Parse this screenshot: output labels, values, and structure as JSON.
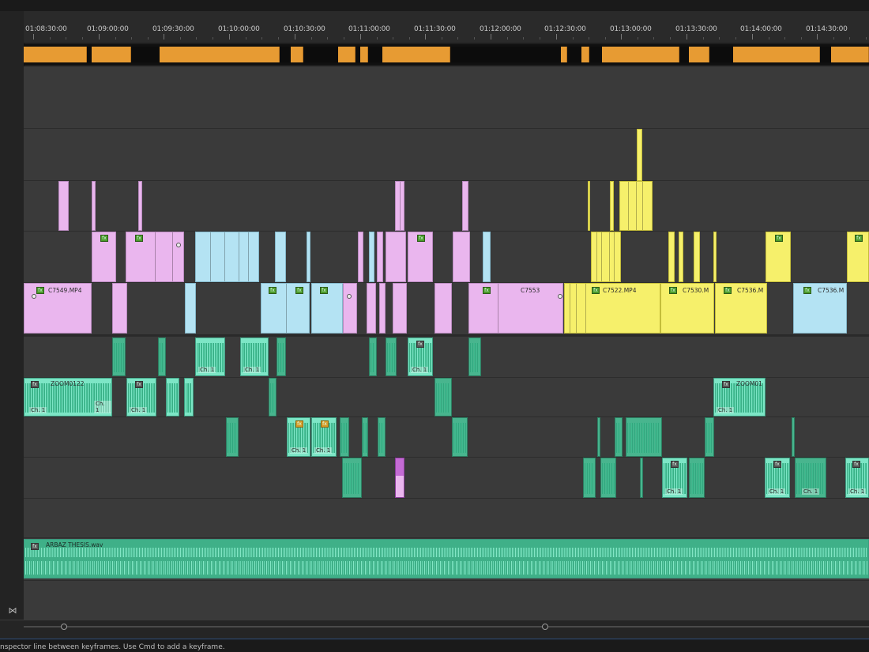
{
  "timeline": {
    "ruler_labels": [
      "01:08:30:00",
      "01:09:00:00",
      "01:09:30:00",
      "01:10:00:00",
      "01:10:30:00",
      "01:11:00:00",
      "01:11:30:00",
      "01:12:00:00",
      "01:12:30:00",
      "01:13:00:00",
      "01:13:30:00",
      "01:14:00:00",
      "01:14:30:00"
    ]
  },
  "clips": {
    "v1_c7549": "C7549.MP4",
    "v1_c7553": "C7553",
    "v1_c7522": "C7522.MP4",
    "v1_c7530": "C7530.M",
    "v1_c7536a": "C7536.M",
    "v1_c7536b": "C7536.M",
    "a2_zoom0122": "ZOOM0122",
    "a2_zoom01": "ZOOM01",
    "a5_arbaz": "ARBAZ THESIS.wav"
  },
  "badges": {
    "fx": "fx",
    "ch": "Ch. 1"
  },
  "status": {
    "text": "nspector line between keyframes. Use Cmd to add a keyframe."
  },
  "colors": {
    "video_pink": "#eab6ee",
    "video_blue": "#b4e3f3",
    "video_yellow": "#f6f06b",
    "audio_green": "#7de6c6",
    "render_orange": "#e79b33"
  }
}
